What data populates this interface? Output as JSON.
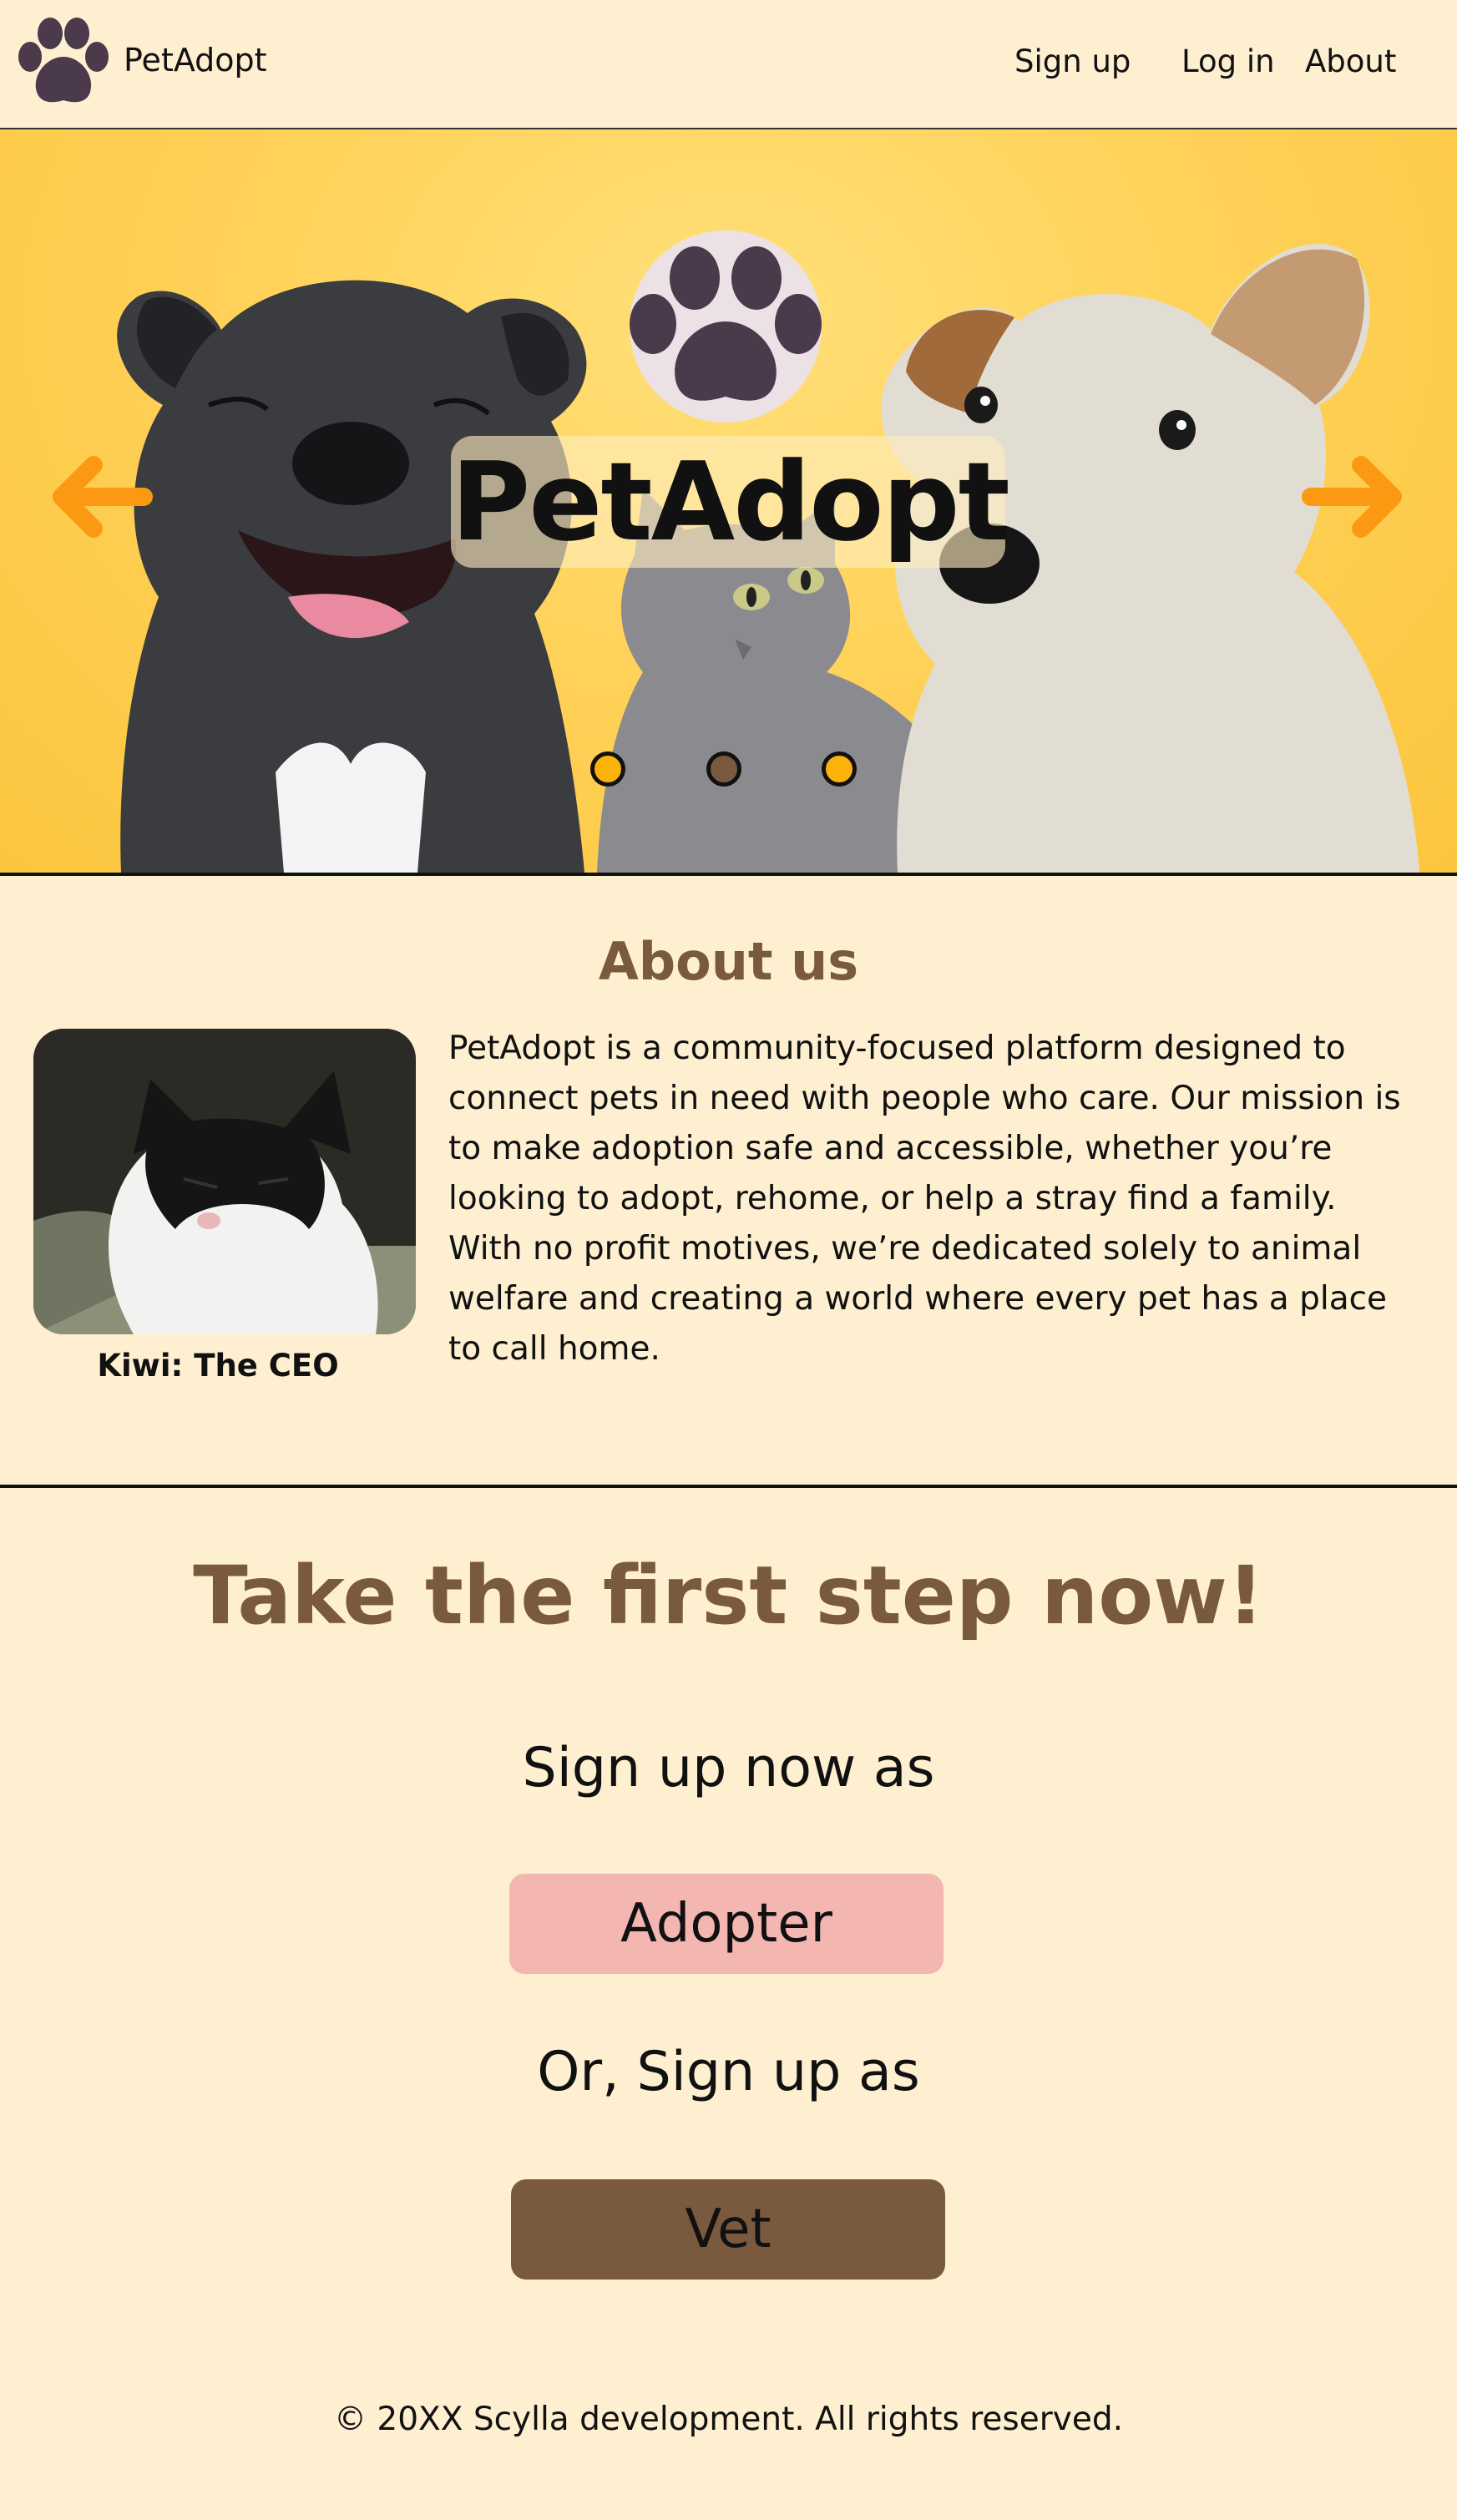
{
  "nav": {
    "brand": "PetAdopt",
    "links": [
      {
        "label": "Sign up"
      },
      {
        "label": "Log in"
      },
      {
        "label": "About"
      }
    ],
    "logo_icon": "paw-icon"
  },
  "hero": {
    "title": "PetAdopt",
    "logo_icon": "paw-icon",
    "prev_icon": "arrow-left-icon",
    "next_icon": "arrow-right-icon",
    "slides": 3,
    "active_slide": 2
  },
  "about": {
    "heading": "About us",
    "caption": "Kiwi: The CEO",
    "text": "PetAdopt is a community-focused platform designed to connect pets in need with people who care. Our mission is to make adoption safe and accessible, whether you’re looking to adopt, rehome, or help a stray find a family. With no profit motives, we’re dedicated solely to animal welfare and creating a world where every pet has a place to call home."
  },
  "cta": {
    "heading": "Take the first step now!",
    "signup_prompt": "Sign up now as",
    "adopter_label": "Adopter",
    "alt_prompt": "Or, Sign up as",
    "vet_label": "Vet"
  },
  "footer": {
    "text": "© 20XX Scylla development. All rights reserved."
  },
  "colors": {
    "background": "#fdefd0",
    "accent_brown": "#7a5a3f",
    "hero_yellow": "#ffd25a",
    "arrow_orange": "#fb9a12",
    "adopter_pink": "#f3b6b0",
    "paw_dark": "#4a3a4c"
  }
}
